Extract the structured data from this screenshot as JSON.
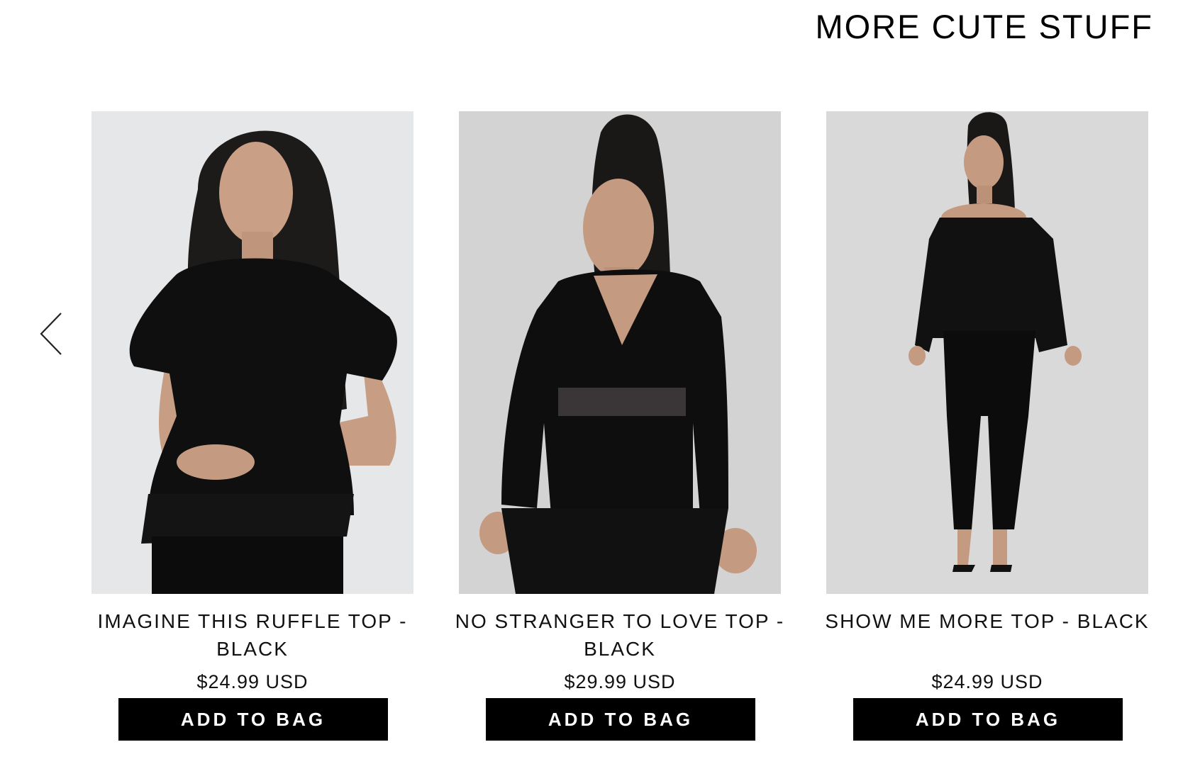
{
  "section": {
    "title": "MORE CUTE STUFF"
  },
  "carousel": {
    "prev_icon": "chevron-left-icon"
  },
  "products": [
    {
      "name": "IMAGINE THIS RUFFLE TOP - BLACK",
      "price": "$24.99 USD",
      "button_label": "ADD TO BAG"
    },
    {
      "name": "NO STRANGER TO LOVE TOP - BLACK",
      "price": "$29.99 USD",
      "button_label": "ADD TO BAG"
    },
    {
      "name": "SHOW ME MORE TOP - BLACK",
      "price": "$24.99 USD",
      "button_label": "ADD TO BAG"
    }
  ],
  "colors": {
    "button_bg": "#000000",
    "button_text": "#ffffff",
    "page_bg": "#ffffff"
  }
}
